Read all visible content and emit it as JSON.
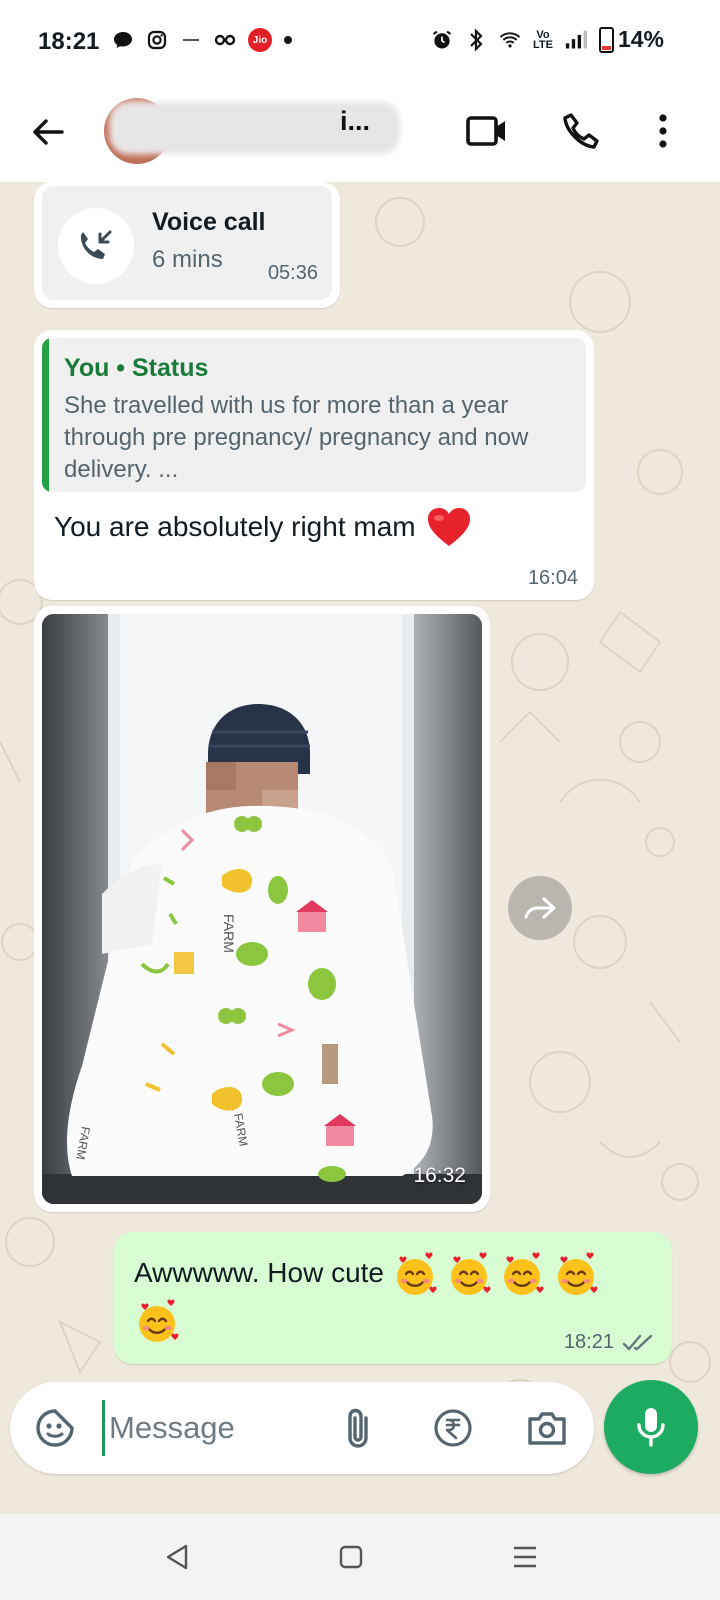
{
  "status_bar": {
    "time": "18:21",
    "volte": "Vo LTE",
    "carrier_badge": "Jio",
    "battery_percent": "14%",
    "battery_level": 0.14,
    "left_icons": [
      "chat-bubble-icon",
      "instagram-icon",
      "small-app-icon",
      "link-icon",
      "jio-icon",
      "dot-icon"
    ],
    "right_icons": [
      "alarm-icon",
      "bluetooth-icon",
      "wifi-icon",
      "volte-icon",
      "signal-icon",
      "battery-icon"
    ]
  },
  "header": {
    "contact_name": "i...",
    "icons": [
      "back-arrow-icon",
      "video-call-icon",
      "phone-icon",
      "more-vert-icon"
    ]
  },
  "messages": {
    "call": {
      "title": "Voice call",
      "duration": "6 mins",
      "time": "05:36",
      "icon": "missed-call-arrow-icon"
    },
    "reply": {
      "quote_title": "You • Status",
      "quote_text": "She travelled with us for more than a year through pre pregnancy/ pregnancy and now delivery. ...",
      "text": "You are absolutely right mam",
      "emoji": "heart-icon",
      "time": "16:04"
    },
    "photo": {
      "time": "16:32",
      "blanket_print": "FARM"
    },
    "outgoing": {
      "text": "Awwwww. How cute",
      "emoji_count": 5,
      "emoji": "smiling-face-with-hearts-icon",
      "time": "18:21",
      "status": "read"
    }
  },
  "input_bar": {
    "placeholder": "Message",
    "icons": [
      "sticker-icon",
      "attach-icon",
      "rupee-payment-icon",
      "camera-icon",
      "mic-icon"
    ]
  },
  "nav_bar": {
    "icons": [
      "nav-back-icon",
      "nav-home-icon",
      "nav-recents-icon"
    ]
  },
  "colors": {
    "chat_bg": "#efe8dc",
    "outgoing_bubble": "#d9fdd3",
    "accent_green": "#1daa61",
    "quote_bar": "#25a244",
    "read_tick": "#53bdeb"
  }
}
